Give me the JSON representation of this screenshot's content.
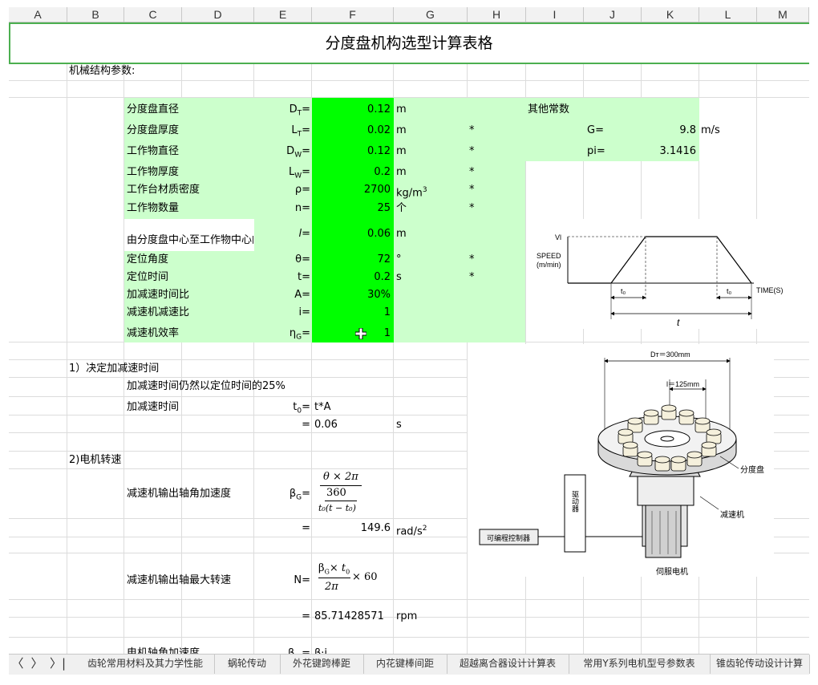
{
  "columns": [
    "A",
    "B",
    "C",
    "D",
    "E",
    "F",
    "G",
    "H",
    "I",
    "J",
    "K",
    "L",
    "M"
  ],
  "title": "分度盘机构选型计算表格",
  "section_header": "机械结构参数:",
  "params": [
    {
      "label": "分度盘直径",
      "sym": "D",
      "sub": "T",
      "val": "0.12",
      "unit": "m",
      "star": "",
      "x1": "其他常数",
      "x2": "",
      "x3": ""
    },
    {
      "label": "分度盘厚度",
      "sym": "L",
      "sub": "T",
      "val": "0.02",
      "unit": "m",
      "star": "*",
      "x1": "",
      "x2": "G=",
      "x3": "9.8",
      "x4": "m/s"
    },
    {
      "label": "工作物直径",
      "sym": "D",
      "sub": "W",
      "val": "0.12",
      "unit": "m",
      "star": "*",
      "x1": "",
      "x2": "pi=",
      "x3": "3.1416"
    },
    {
      "label": "工作物厚度",
      "sym": "L",
      "sub": "W",
      "val": "0.2",
      "unit": "m",
      "star": "*"
    },
    {
      "label": "工作台材质密度",
      "sym": "ρ=",
      "val": "2700",
      "unit": "kg/m",
      "unit_sup": "3",
      "star": "*"
    },
    {
      "label": "工作物数量",
      "sym": "n=",
      "val": "25",
      "unit": "个",
      "star": "*"
    },
    {
      "label": "由分度盘中心至工作物中心的",
      "sym": "l=",
      "val": "0.06",
      "unit": "m"
    },
    {
      "label": "定位角度",
      "sym": "θ=",
      "val": "72",
      "unit": "°",
      "star": "*"
    },
    {
      "label": "定位时间",
      "sym": "t=",
      "val": "0.2",
      "unit": "s",
      "star": "*"
    },
    {
      "label": "加减速时间比",
      "sym": "A=",
      "val": "30%"
    },
    {
      "label": "减速机减速比",
      "sym": "i=",
      "val": "1"
    },
    {
      "label": "减速机效率",
      "sym": "η",
      "sub": "G",
      "val": "1"
    }
  ],
  "step1": {
    "title": "1）决定加减速时间",
    "note": "加减速时间仍然以定位时间的25%",
    "label": "加减速时间",
    "sym": "t",
    "sub": "0",
    "formula": "t*A",
    "eq": "=",
    "val": "0.06",
    "unit": "s"
  },
  "step2": {
    "title": "2)电机转速",
    "label1": "减速机输出轴角加速度",
    "sym1": "β",
    "sub1": "G",
    "num1": "θ × 2π",
    "den1a": "360",
    "den1b": "t₀(t − t₀)",
    "eq1": "=",
    "val1": "149.6",
    "unit1": "rad/s",
    "unit1_sup": "2",
    "label2": "减速机输出轴最大转速",
    "sym2": "N=",
    "f2a": "β",
    "f2a_sub": "G",
    "f2b": "× t",
    "f2b_sub": "0",
    "f2c": "2π",
    "f2d": "× 60",
    "eq2": "=",
    "val2": "85.71428571",
    "unit2": "rpm",
    "label3": "电机轴角加速度",
    "sym3": "β",
    "sub3": "m",
    "f3": "β",
    "f3b": "·i"
  },
  "speed_diagram": {
    "y_label": "SPEED",
    "y_unit": "(m/min)",
    "vl": "Vl",
    "x_label": "TIME(S)",
    "t0": "t₀",
    "t": "t"
  },
  "turntable_diagram": {
    "dt": "Dт＝300mm",
    "l": "l＝125mm",
    "turntable": "分度盘",
    "reducer": "减速机",
    "servo": "伺服电机",
    "driver": "驱动器",
    "plc": "可编程控制器"
  },
  "sheet_tabs": [
    "齿轮常用材料及其力学性能",
    "蜗轮传动",
    "外花键跨棒距",
    "内花键棒间距",
    "超越离合器设计计算表",
    "常用Y系列电机型号参数表",
    "锥齿轮传动设计计算"
  ],
  "nav": {
    "first": "〈",
    "prev": "〈",
    "next": "〉",
    "last": "〉|"
  }
}
